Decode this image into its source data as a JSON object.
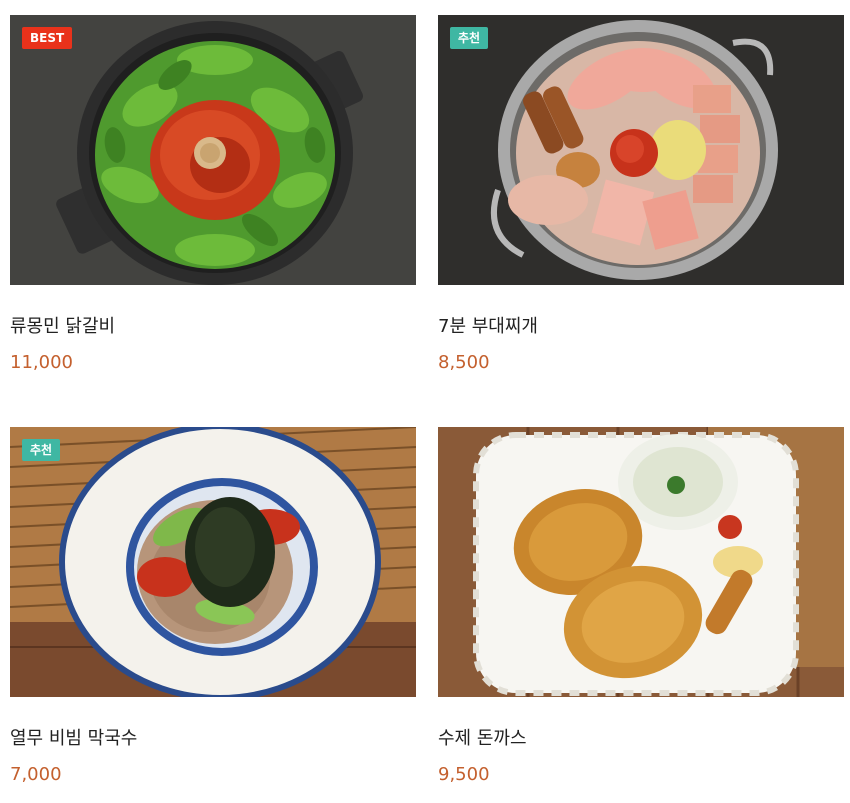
{
  "menu_items": [
    {
      "name": "류몽민 닭갈비",
      "price": "11,000",
      "badge": "BEST"
    },
    {
      "name": "7분 부대찌개",
      "price": "8,500",
      "badge": "추천"
    },
    {
      "name": "열무 비빔 막국수",
      "price": "7,000",
      "badge": "추천"
    },
    {
      "name": "수제 돈까스",
      "price": "9,500",
      "badge": ""
    }
  ],
  "colors": {
    "price": "#c4602e",
    "badge_best": "#e9321b",
    "badge_recommend": "#3fb7a3"
  }
}
